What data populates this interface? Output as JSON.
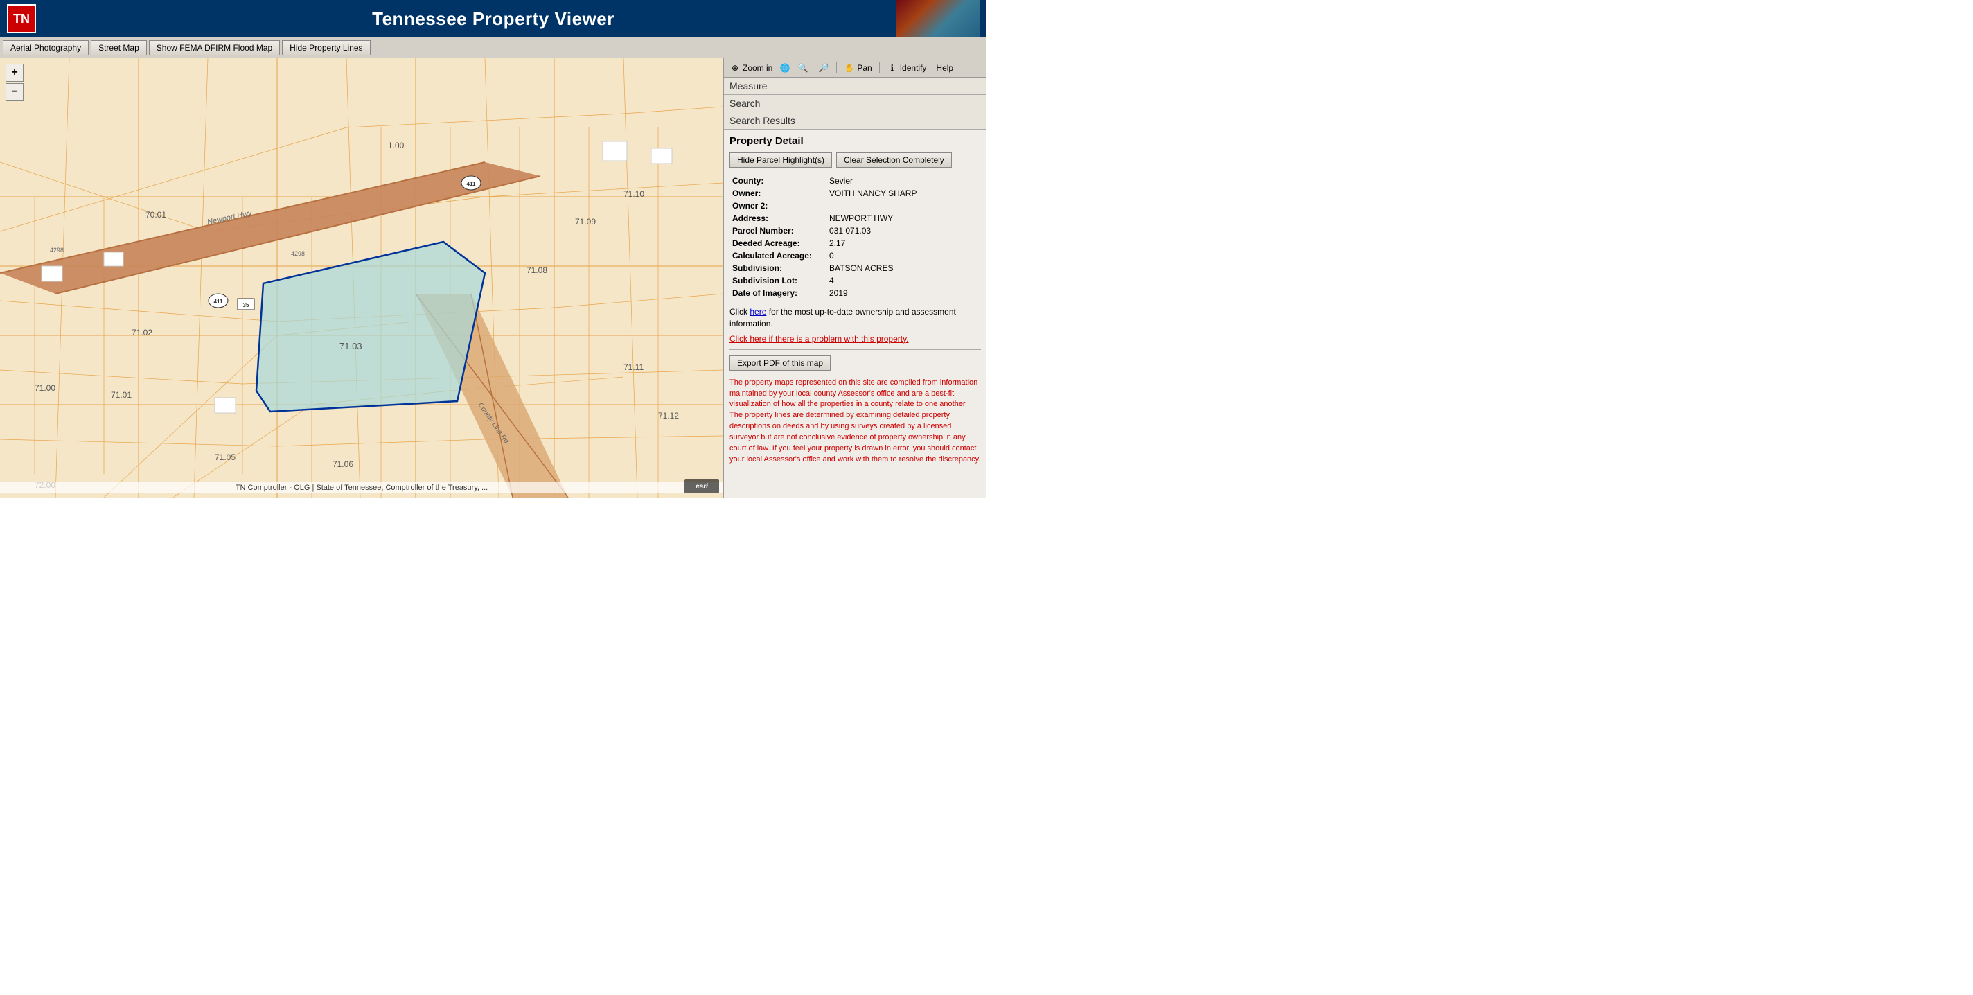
{
  "header": {
    "logo_text": "TN",
    "title": "Tennessee Property Viewer"
  },
  "toolbar": {
    "buttons": [
      {
        "id": "aerial",
        "label": "Aerial Photography"
      },
      {
        "id": "street",
        "label": "Street Map"
      },
      {
        "id": "fema",
        "label": "Show FEMA DFIRM Flood Map"
      },
      {
        "id": "property_lines",
        "label": "Hide Property Lines"
      }
    ]
  },
  "map_toolbar": {
    "zoom_in_label": "Zoom in",
    "pan_label": "Pan",
    "identify_label": "Identify",
    "help_label": "Help"
  },
  "zoom_controls": {
    "plus": "+",
    "minus": "−"
  },
  "map_attribution": "TN Comptroller - OLG | State of Tennessee, Comptroller of the Treasury, ...",
  "panel": {
    "measure_label": "Measure",
    "search_label": "Search",
    "search_results_label": "Search Results",
    "property_detail_label": "Property Detail",
    "hide_parcel_btn": "Hide Parcel Highlight(s)",
    "clear_selection_btn": "Clear Selection Completely",
    "fields": [
      {
        "label": "County:",
        "value": "Sevier"
      },
      {
        "label": "Owner:",
        "value": "VOITH NANCY SHARP"
      },
      {
        "label": "Owner 2:",
        "value": ""
      },
      {
        "label": "Address:",
        "value": "NEWPORT HWY"
      },
      {
        "label": "Parcel Number:",
        "value": "031 071.03"
      },
      {
        "label": "Deeded Acreage:",
        "value": "2.17"
      },
      {
        "label": "Calculated Acreage:",
        "value": "0"
      },
      {
        "label": "Subdivision:",
        "value": "BATSON ACRES"
      },
      {
        "label": "Subdivision Lot:",
        "value": "4"
      },
      {
        "label": "Date of Imagery:",
        "value": "2019"
      }
    ],
    "click_here_text": "Click ",
    "click_here_link": "here",
    "click_here_suffix": " for the most up-to-date ownership and assessment information.",
    "problem_link": "Click here if there is a problem with this property.",
    "export_btn": "Export PDF of this map",
    "disclaimer": "The property maps represented on this site are compiled from information maintained by your local county Assessor's office and are a best-fit visualization of how all the properties in a county relate to one another. The property lines are determined by examining detailed property descriptions on deeds and by using surveys created by a licensed surveyor but are not conclusive evidence of property ownership in any court of law. If you feel your property is drawn in error, you should contact your local Assessor's office and work with them to resolve the discrepancy."
  }
}
